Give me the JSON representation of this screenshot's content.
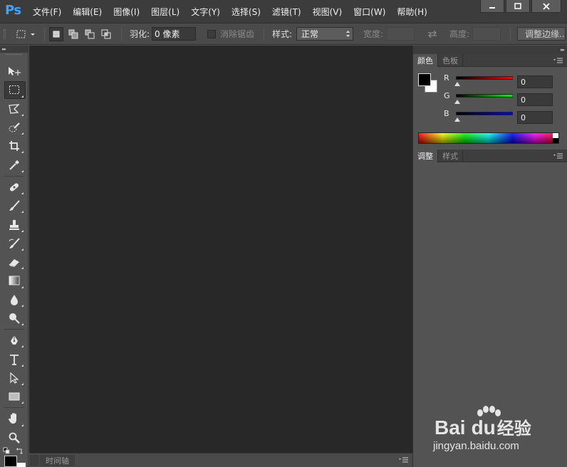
{
  "app": {
    "logo": "Ps"
  },
  "menu": [
    "文件(F)",
    "编辑(E)",
    "图像(I)",
    "图层(L)",
    "文字(Y)",
    "选择(S)",
    "滤镜(T)",
    "视图(V)",
    "窗口(W)",
    "帮助(H)"
  ],
  "options": {
    "feather_label": "羽化:",
    "feather_value": "0 像素",
    "antialias_label": "消除锯齿",
    "style_label": "样式:",
    "style_value": "正常",
    "width_label": "宽度:",
    "height_label": "高度:",
    "refine_label": "调整边缘..."
  },
  "tools": [
    "move-tool",
    "marquee-tool",
    "lasso-tool",
    "quick-select-tool",
    "crop-tool",
    "eyedropper-tool",
    "healing-tool",
    "brush-tool",
    "stamp-tool",
    "history-brush-tool",
    "eraser-tool",
    "gradient-tool",
    "blur-tool",
    "dodge-tool",
    "pen-tool",
    "type-tool",
    "path-select-tool",
    "shape-tool",
    "hand-tool",
    "zoom-tool"
  ],
  "timeline": {
    "tab": "时间轴"
  },
  "color_panel": {
    "tabs": [
      "颜色",
      "色板"
    ],
    "channels": [
      {
        "label": "R",
        "value": "0",
        "color": "#ff0000"
      },
      {
        "label": "G",
        "value": "0",
        "color": "#00ff00"
      },
      {
        "label": "B",
        "value": "0",
        "color": "#0000ff"
      }
    ],
    "foreground": "#000000",
    "background": "#ffffff"
  },
  "adjust_panel": {
    "tabs": [
      "调整",
      "样式"
    ]
  },
  "watermark": {
    "brand": "Bai",
    "brand2": "du",
    "suffix": "经验",
    "url": "jingyan.baidu.com"
  }
}
